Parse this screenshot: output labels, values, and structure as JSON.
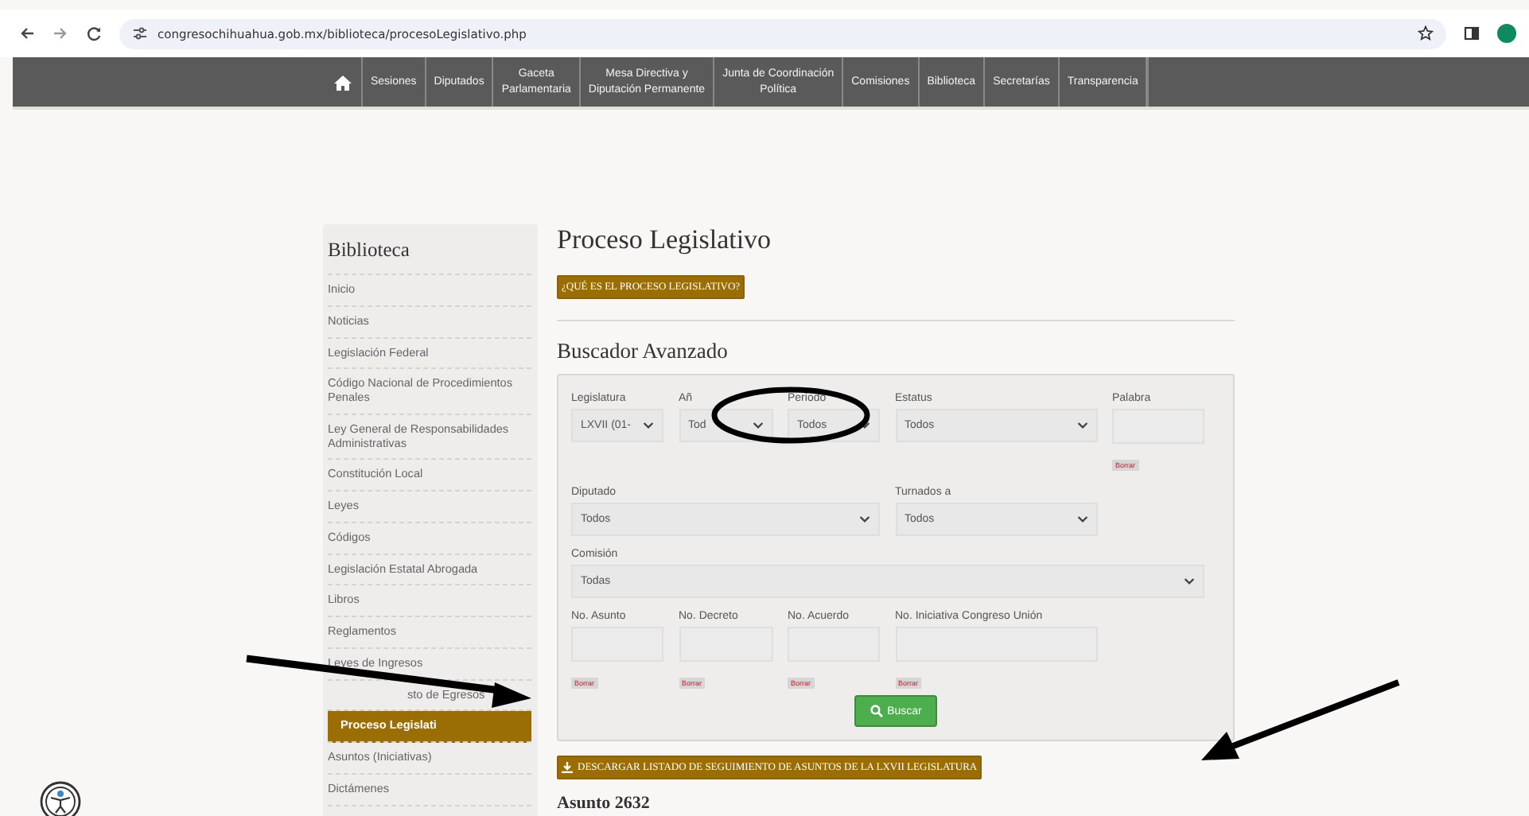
{
  "browser": {
    "url": "congresochihuahua.gob.mx/biblioteca/procesoLegislativo.php"
  },
  "nav": {
    "items": [
      {
        "label": "Sesiones"
      },
      {
        "label": "Diputados"
      },
      {
        "label": "Gaceta\nParlamentaria"
      },
      {
        "label": "Mesa Directiva y\nDiputación Permanente"
      },
      {
        "label": "Junta de Coordinación\nPolítica"
      },
      {
        "label": "Comisiones"
      },
      {
        "label": "Biblioteca"
      },
      {
        "label": "Secretarías"
      },
      {
        "label": "Transparencia"
      }
    ]
  },
  "sidebar": {
    "title": "Biblioteca",
    "items": [
      {
        "label": "Inicio",
        "selected": false,
        "kind": "link"
      },
      {
        "label": "Noticias",
        "selected": false,
        "kind": "link"
      },
      {
        "label": "Legislación Federal",
        "selected": false,
        "kind": "link"
      },
      {
        "label": "Código Nacional de Procedimientos Penales",
        "selected": false,
        "kind": "link"
      },
      {
        "label": "Ley General de Responsabilidades Administrativas",
        "selected": false,
        "kind": "link"
      },
      {
        "label": "Constitución Local",
        "selected": false,
        "kind": "link"
      },
      {
        "label": "Leyes",
        "selected": false,
        "kind": "link"
      },
      {
        "label": "Códigos",
        "selected": false,
        "kind": "link"
      },
      {
        "label": "Legislación Estatal Abrogada",
        "selected": false,
        "kind": "link"
      },
      {
        "label": "Libros",
        "selected": false,
        "kind": "link"
      },
      {
        "label": "Reglamentos",
        "selected": false,
        "kind": "link"
      },
      {
        "label": "Leyes de Ingresos",
        "selected": false,
        "kind": "link"
      },
      {
        "label": "sto de Egresos",
        "selected": false,
        "kind": "covered"
      },
      {
        "label": "Proceso Legislati",
        "selected": true,
        "kind": "link"
      },
      {
        "label": "Asuntos (Iniciativas)",
        "selected": false,
        "kind": "link"
      },
      {
        "label": "Dictámenes",
        "selected": false,
        "kind": "link"
      }
    ]
  },
  "main": {
    "title": "Proceso Legislativo",
    "info_button": "¿QUÉ ES EL PROCESO LEGISLATIVO?",
    "search": {
      "title": "Buscador Avanzado",
      "rows": [
        [
          {
            "kind": "select",
            "label": "Legislatura",
            "value": "LXVII (01-"
          },
          {
            "kind": "select",
            "label": "Añ",
            "value": "Tod"
          },
          {
            "kind": "select",
            "label": "Periodo",
            "value": "Todos"
          },
          {
            "kind": "select",
            "label": "Estatus",
            "value": "Todos"
          },
          {
            "kind": "text",
            "label": "Palabra",
            "clear": "Borrar"
          }
        ],
        [
          {
            "kind": "select",
            "label": "Diputado",
            "value": "Todos"
          },
          "",
          "",
          {
            "kind": "select",
            "label": "Turnados a",
            "value": "Todos"
          }
        ],
        [
          {
            "kind": "select",
            "label": "Comisión",
            "value": "Todas"
          },
          "",
          "",
          "",
          ""
        ],
        [
          {
            "kind": "text",
            "label": "No. Asunto",
            "clear": "Borrar"
          },
          {
            "kind": "text",
            "label": "No. Decreto",
            "clear": "Borrar"
          },
          {
            "kind": "text",
            "label": "No. Acuerdo",
            "clear": "Borrar"
          },
          {
            "kind": "text",
            "label": "No. Iniciativa Congreso Unión",
            "clear": "Borrar"
          }
        ]
      ],
      "button": "Buscar"
    },
    "download_button": "DESCARGAR LISTADO DE SEGUIMIENTO DE ASUNTOS DE LA LXVII LEGISLATURA",
    "next_heading": "Asunto 2632"
  }
}
